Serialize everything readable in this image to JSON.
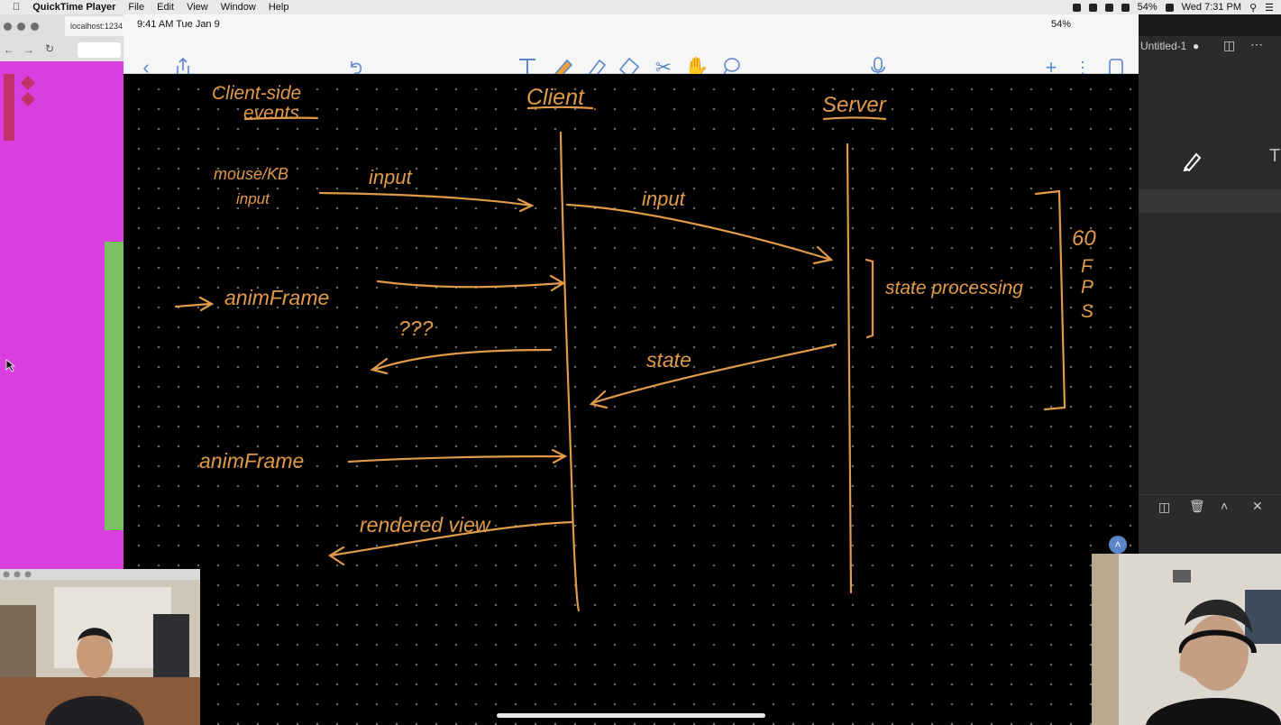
{
  "menubar": {
    "app_name": "QuickTime Player",
    "items": [
      "File",
      "Edit",
      "View",
      "Window",
      "Help"
    ],
    "battery": "54%",
    "clock": "Wed 7:31 PM"
  },
  "browser": {
    "tab_title": "localhost:1234"
  },
  "ipad": {
    "status_time": "9:41 AM   Tue Jan 9",
    "status_battery": "54%",
    "toolbar": {
      "back_icon": "chevron-left-icon",
      "share_icon": "share-icon",
      "undo_icon": "undo-icon",
      "tools": [
        "text-tool-icon",
        "pencil-tool-icon",
        "highlighter-tool-icon",
        "eraser-tool-icon",
        "scissors-tool-icon",
        "hand-tool-icon",
        "lasso-tool-icon"
      ],
      "mic_icon": "microphone-icon",
      "add_icon": "plus-icon",
      "more_icon": "more-icon",
      "page_icon": "page-icon"
    },
    "ink_color": "#e09a4a",
    "sketch": {
      "client_side_events": "Client-side",
      "events": "events",
      "client": "Client",
      "server": "Server",
      "mouse_kb": "mouse/KB",
      "input_small": "input",
      "input_left": "input",
      "input_right": "input",
      "animframe_1": "animFrame",
      "unknown": "???",
      "state": "state",
      "state_processing": "state processing",
      "fps_60": "60",
      "fps_f": "F",
      "fps_p": "P",
      "fps_s": "S",
      "animframe_2": "animFrame",
      "rendered_view": "rendered view"
    }
  },
  "sidebar": {
    "tab_title": "Untitled-1"
  }
}
